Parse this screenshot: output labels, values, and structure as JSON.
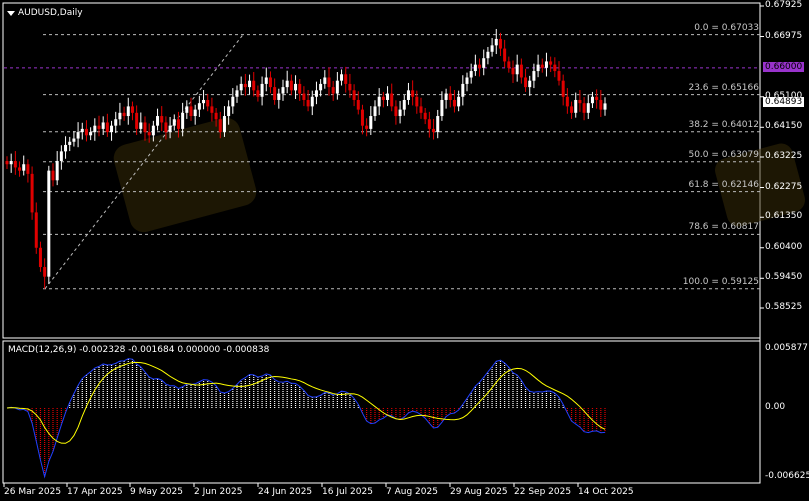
{
  "header": {
    "symbol_title": "AUDUSD,Daily"
  },
  "price_axis": {
    "labels": [
      "0.67925",
      "0.66975",
      "0.65100",
      "0.64150",
      "0.63225",
      "0.62275",
      "0.61350",
      "0.60400",
      "0.59450",
      "0.58525"
    ],
    "values": [
      0.67925,
      0.66975,
      0.651,
      0.6415,
      0.63225,
      0.62275,
      0.6135,
      0.604,
      0.5945,
      0.58525
    ]
  },
  "current_price": {
    "label": "0.64893",
    "value": 0.64893
  },
  "level_line": {
    "label": "0.66000",
    "value": 0.66,
    "color": "#9933cc"
  },
  "fibonacci": [
    {
      "label": "0.0 = 0.67033",
      "value": 0.67033
    },
    {
      "label": "23.6 = 0.65166",
      "value": 0.65166
    },
    {
      "label": "38.2 = 0.64012",
      "value": 0.64012
    },
    {
      "label": "50.0 = 0.63079",
      "value": 0.63079
    },
    {
      "label": "61.8 = 0.62146",
      "value": 0.62146
    },
    {
      "label": "78.6 = 0.60817",
      "value": 0.60817
    },
    {
      "label": "100.0 = 0.59125",
      "value": 0.59125
    }
  ],
  "macd": {
    "label": "MACD(12,26,9) -0.002328 -0.001684 0.000000 -0.000838",
    "axis": [
      "0.005877",
      "0.00",
      "-0.006625"
    ],
    "axis_values": [
      0.005877,
      0,
      -0.006625
    ]
  },
  "dates": [
    "26 Mar 2025",
    "17 Apr 2025",
    "9 May 2025",
    "2 Jun 2025",
    "24 Jun 2025",
    "16 Jul 2025",
    "7 Aug 2025",
    "29 Aug 2025",
    "22 Sep 2025",
    "14 Oct 2025"
  ],
  "chart_data": {
    "type": "candlestick",
    "title": "AUDUSD,Daily",
    "ylim": [
      0.58525,
      0.67925
    ],
    "closes": [
      0.63,
      0.631,
      0.629,
      0.628,
      0.63,
      0.627,
      0.615,
      0.604,
      0.598,
      0.595,
      0.628,
      0.625,
      0.631,
      0.634,
      0.636,
      0.637,
      0.638,
      0.64,
      0.641,
      0.639,
      0.64,
      0.642,
      0.641,
      0.643,
      0.64,
      0.642,
      0.644,
      0.646,
      0.645,
      0.648,
      0.646,
      0.641,
      0.643,
      0.64,
      0.639,
      0.642,
      0.645,
      0.643,
      0.64,
      0.642,
      0.644,
      0.641,
      0.646,
      0.648,
      0.645,
      0.647,
      0.649,
      0.65,
      0.648,
      0.646,
      0.644,
      0.64,
      0.645,
      0.648,
      0.651,
      0.653,
      0.655,
      0.654,
      0.656,
      0.653,
      0.651,
      0.655,
      0.657,
      0.654,
      0.65,
      0.652,
      0.654,
      0.656,
      0.653,
      0.655,
      0.652,
      0.65,
      0.648,
      0.651,
      0.653,
      0.655,
      0.657,
      0.654,
      0.652,
      0.656,
      0.658,
      0.655,
      0.653,
      0.65,
      0.647,
      0.642,
      0.641,
      0.645,
      0.648,
      0.651,
      0.65,
      0.652,
      0.648,
      0.645,
      0.647,
      0.65,
      0.653,
      0.651,
      0.648,
      0.646,
      0.644,
      0.641,
      0.64,
      0.645,
      0.65,
      0.652,
      0.65,
      0.648,
      0.651,
      0.655,
      0.657,
      0.659,
      0.661,
      0.66,
      0.663,
      0.665,
      0.667,
      0.669,
      0.666,
      0.662,
      0.66,
      0.658,
      0.661,
      0.657,
      0.654,
      0.656,
      0.659,
      0.661,
      0.66,
      0.662,
      0.661,
      0.659,
      0.656,
      0.651,
      0.648,
      0.646,
      0.65,
      0.649,
      0.646,
      0.649,
      0.651,
      0.65,
      0.647,
      0.64893
    ],
    "low_point": 0.59125
  }
}
